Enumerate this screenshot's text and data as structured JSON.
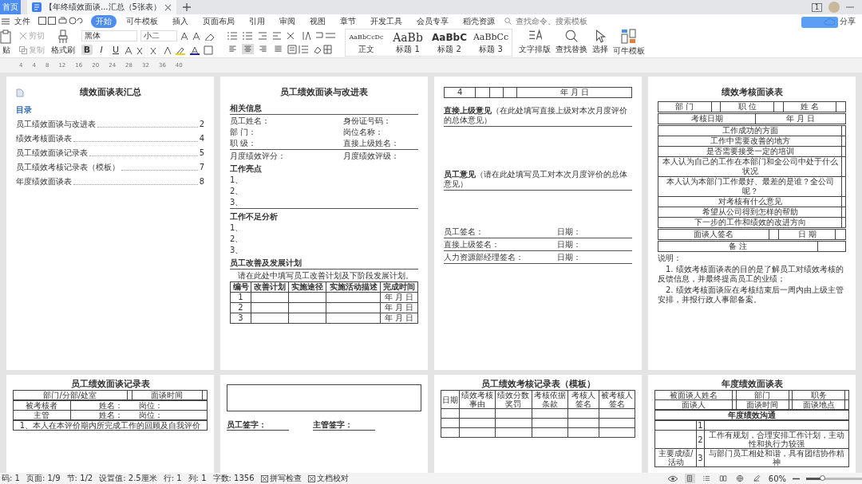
{
  "tabs": {
    "home": "首页",
    "document": {
      "title": "【年终绩效面谈...汇总（5张表）",
      "selected": true
    }
  },
  "title_bar": {
    "window_count": "1"
  },
  "menu": {
    "file": "文件",
    "items": [
      {
        "label": "开始",
        "selected": true
      },
      {
        "label": "可牛模板",
        "selected": false
      },
      {
        "label": "插入",
        "selected": false
      },
      {
        "label": "页面布局",
        "selected": false
      },
      {
        "label": "引用",
        "selected": false
      },
      {
        "label": "审阅",
        "selected": false
      },
      {
        "label": "视图",
        "selected": false
      },
      {
        "label": "章节",
        "selected": false
      },
      {
        "label": "开发工具",
        "selected": false
      },
      {
        "label": "会员专享",
        "selected": false
      },
      {
        "label": "稻壳资源",
        "selected": false
      }
    ],
    "search": {
      "placeholder": "查找命令、搜索模板"
    },
    "share": "分享"
  },
  "toolbar": {
    "paste": "贴",
    "cut": "剪切",
    "copy": "复制",
    "painter": "格式刷",
    "font": "黑体",
    "size": "小二",
    "format": [
      {
        "label": "B",
        "selected": true
      },
      {
        "label": "I",
        "selected": false
      },
      {
        "label": "U",
        "selected": false
      }
    ],
    "align": [
      {
        "selected": false
      },
      {
        "selected": true
      },
      {
        "selected": false
      },
      {
        "selected": false
      }
    ],
    "styles": [
      {
        "preview": "AaBbCcDc",
        "label": "正文",
        "kind": "body"
      },
      {
        "preview": "AaBb",
        "label": "标题 1",
        "kind": "h1"
      },
      {
        "preview": "AaBbC",
        "label": "标题 2",
        "kind": "h2"
      },
      {
        "preview": "AaBbCc",
        "label": "标题 3",
        "kind": "h3"
      }
    ],
    "tools": [
      {
        "label": "文字排版",
        "kind": "layout"
      },
      {
        "label": "查找替换",
        "kind": "find"
      },
      {
        "label": "选择",
        "kind": "select"
      },
      {
        "label": "可牛模板",
        "kind": "template"
      }
    ]
  },
  "ruler": [
    "4",
    "4",
    "8",
    "12",
    "16",
    "20",
    "24",
    "28",
    "32",
    "36",
    "40"
  ],
  "pages": [
    {
      "blocks": [
        {
          "kind": "title",
          "text": "绩效面谈表汇总",
          "icon": true
        },
        {
          "kind": "toc_head",
          "text": "目录"
        },
        {
          "kind": "toc",
          "label": "员工绩效面谈与改进表",
          "page": "2"
        },
        {
          "kind": "toc",
          "label": "绩效考核面谈表",
          "page": "4"
        },
        {
          "kind": "toc",
          "label": "员工绩效面谈记录表",
          "page": "5"
        },
        {
          "kind": "toc",
          "label": "员工绩效考核记录表（模板）",
          "page": "7"
        },
        {
          "kind": "toc",
          "label": "年度绩效面谈表",
          "page": "8"
        }
      ]
    },
    {
      "blocks": [
        {
          "kind": "title",
          "text": "员工绩效面谈与改进表"
        },
        {
          "kind": "heading",
          "text": "相关信息",
          "rule": true
        },
        {
          "kind": "fields",
          "items": [
            "员工姓名：",
            "身份证号码："
          ]
        },
        {
          "kind": "fields",
          "items": [
            "部 门：",
            "岗位名称："
          ]
        },
        {
          "kind": "fields",
          "items": [
            "职 级：",
            "直接上级姓名："
          ],
          "rule": true
        },
        {
          "kind": "fields",
          "items": [
            "月度绩效评分：",
            "月度绩效评级："
          ]
        },
        {
          "kind": "heading",
          "text": "工作亮点"
        },
        {
          "kind": "text",
          "text": "1、"
        },
        {
          "kind": "text",
          "text": "2、"
        },
        {
          "kind": "text",
          "text": "3、",
          "rule": true
        },
        {
          "kind": "heading",
          "text": "工作不足分析"
        },
        {
          "kind": "text",
          "text": "1、"
        },
        {
          "kind": "text",
          "text": "2、"
        },
        {
          "kind": "text",
          "text": "3、"
        },
        {
          "kind": "heading",
          "text": "员工改善及发展计划",
          "rule": true
        },
        {
          "kind": "text",
          "text": "请在此处中填写员工改善计划及下阶段发展计划。",
          "indent": true
        },
        {
          "kind": "table",
          "header": true,
          "rows": [
            [
              "编号",
              "改善计划",
              "实施途径",
              "实施活动描述",
              "完成时间"
            ],
            [
              "1",
              null,
              null,
              null,
              "年 月 日"
            ],
            [
              "2",
              null,
              null,
              null,
              "年 月 日"
            ],
            [
              "3",
              null,
              null,
              null,
              "年 月 日"
            ]
          ]
        }
      ]
    },
    {
      "blocks": [
        {
          "kind": "table",
          "rows": [
            [
              "4",
              null,
              null,
              null,
              "年 月 日"
            ]
          ]
        },
        {
          "kind": "opinion",
          "text": "**直接上级意见**（在此处填写直接上级对本次月度评价的总体意见）"
        },
        {
          "kind": "opinion",
          "text": "**员工意见**（请在此处填写员工对本次月度评价的总体意见）"
        },
        {
          "kind": "fields",
          "items": [
            "员工签名：",
            "日期："
          ],
          "rule": true
        },
        {
          "kind": "fields",
          "items": [
            "直接上级签名：",
            "日期："
          ],
          "rule": true
        },
        {
          "kind": "fields",
          "items": [
            "人力资源部经理签名：",
            "日期："
          ],
          "rule": true
        }
      ]
    },
    {
      "blocks": [
        {
          "kind": "title",
          "text": "绩效考核面谈表"
        },
        {
          "kind": "table",
          "rows": [
            [
              "部 门",
              null,
              "职 位",
              null,
              "姓 名",
              null
            ]
          ]
        },
        {
          "kind": "table",
          "rows": [
            [
              "考核日期",
              "年 月 日"
            ]
          ]
        },
        {
          "kind": "table",
          "rows": [
            [
              "工作成功的方面",
              null
            ],
            [
              "工作中需要改善的地方",
              null
            ],
            [
              "是否需要接受一定的培训",
              null
            ],
            [
              "本人认为自己的工作在本部门和全公司中处于什么状况",
              null
            ],
            [
              "本人认为本部门工作最好、最差的是谁？全公司呢？",
              null
            ],
            [
              "对考核有什么意见",
              null
            ],
            [
              "希望从公司得到怎样的帮助",
              null
            ],
            [
              "下一步的工作和绩效的改进方向",
              null
            ]
          ]
        },
        {
          "kind": "table",
          "rows": [
            [
              "面谈人签名",
              null,
              "日 期",
              null
            ]
          ]
        },
        {
          "kind": "table",
          "rows": [
            [
              "备 注",
              null
            ]
          ]
        },
        {
          "kind": "text",
          "text": "说明："
        },
        {
          "kind": "text",
          "text": "1. 绩效考核面谈表的目的是了解员工对绩效考核的反馈信息，并最终提高员工的业绩；",
          "indent": true
        },
        {
          "kind": "text",
          "text": "2. 绩效考核面谈应在考核结束后一周内由上级主管安排，并报行政人事部备案。",
          "indent": true
        }
      ]
    },
    {
      "blocks": [
        {
          "kind": "title",
          "text": "员工绩效面谈记录表"
        },
        {
          "kind": "table",
          "rows": [
            [
              "部门/分部/处室",
              null,
              "面谈时间",
              null
            ]
          ]
        },
        {
          "kind": "table",
          "rows": [
            [
              "被考核者",
              {
                "parts": [
                  "姓名：",
                  "岗位："
                ]
              }
            ],
            [
              "主管",
              {
                "parts": [
                  "姓名：",
                  "岗位："
                ]
              }
            ]
          ]
        },
        {
          "kind": "table",
          "rows": [
            [
              "1、本人在本评价期内所完成工作的回顾及自我评价"
            ]
          ]
        }
      ]
    },
    {
      "blocks": [
        {
          "kind": "box"
        },
        {
          "kind": "signs",
          "items": [
            "员工签字：",
            "主管签字："
          ]
        }
      ]
    },
    {
      "blocks": [
        {
          "kind": "title",
          "text": "员工绩效考核记录表（模板）"
        },
        {
          "kind": "table",
          "rows": [
            [
              "日期",
              "绩效考核事由",
              "绩效分数奖罚",
              "考核依据条款",
              "考核人签名",
              "被考核人签名"
            ],
            [
              null,
              null,
              null,
              null,
              null,
              null
            ],
            [
              null,
              null,
              null,
              null,
              null,
              null
            ],
            [
              null,
              null,
              null,
              null,
              null,
              null
            ]
          ]
        }
      ]
    },
    {
      "blocks": [
        {
          "kind": "title",
          "text": "年度绩效面谈表"
        },
        {
          "kind": "table",
          "rows": [
            [
              "被面谈人姓名",
              null,
              "部门",
              null,
              "职务",
              null
            ],
            [
              "面谈人",
              null,
              "面谈时间",
              null,
              "面谈地点",
              null
            ]
          ]
        },
        {
          "kind": "table",
          "header": true,
          "rows": [
            [
              "年度绩效沟通"
            ]
          ]
        },
        {
          "kind": "table",
          "rows": [
            [
              null,
              "1",
              null
            ],
            [
              null,
              "2",
              "工作有规划，合理安排工作计划，主动性和执行力较强"
            ],
            [
              "主要成绩/活动",
              "3",
              "与部门员工相处和谐，具有团结协作精神"
            ]
          ]
        }
      ]
    }
  ],
  "status": {
    "items": [
      "码: 1",
      "页面: 1/9",
      "节: 1/2",
      "设置值: 2.5厘米",
      "行: 1",
      "列: 1",
      "字数: 1356"
    ],
    "checks": [
      "拼写检查",
      "文档校对"
    ],
    "views": [
      {
        "selected": true
      },
      {
        "selected": false
      },
      {
        "selected": false
      },
      {
        "selected": false
      },
      {
        "selected": false
      }
    ],
    "zoom": {
      "label": "60%",
      "level": 0.3
    }
  }
}
